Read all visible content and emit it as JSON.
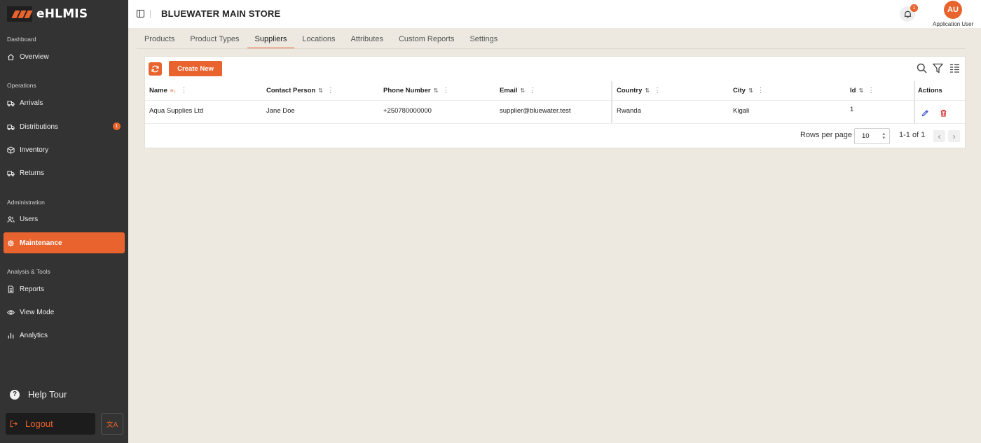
{
  "brand": {
    "name": "eHLMIS",
    "accent": "#e8632e"
  },
  "sidebar": {
    "sections": [
      {
        "label": "Dashboard"
      },
      {
        "label": "Operations"
      },
      {
        "label": "Administration"
      },
      {
        "label": "Analysis & Tools"
      }
    ],
    "items": [
      {
        "label": "Overview",
        "icon": "home-icon"
      },
      {
        "label": "Arrivals",
        "icon": "truck-icon"
      },
      {
        "label": "Distributions",
        "icon": "truck-icon",
        "badge": "1"
      },
      {
        "label": "Inventory",
        "icon": "box-icon"
      },
      {
        "label": "Returns",
        "icon": "truck-icon"
      },
      {
        "label": "Users",
        "icon": "users-icon"
      },
      {
        "label": "Maintenance",
        "icon": "gear-icon",
        "active": true
      },
      {
        "label": "Reports",
        "icon": "document-icon"
      },
      {
        "label": "View Mode",
        "icon": "eye-icon"
      },
      {
        "label": "Analytics",
        "icon": "bar-chart-icon"
      }
    ],
    "help_tour": "Help Tour",
    "logout": "Logout"
  },
  "header": {
    "store_title": "BLUEWATER MAIN STORE",
    "notification_count": "1",
    "avatar_initials": "AU",
    "user_name": "Application User"
  },
  "tabs": [
    {
      "label": "Products"
    },
    {
      "label": "Product Types"
    },
    {
      "label": "Suppliers",
      "active": true
    },
    {
      "label": "Locations"
    },
    {
      "label": "Attributes"
    },
    {
      "label": "Custom Reports"
    },
    {
      "label": "Settings"
    }
  ],
  "toolbar": {
    "create_label": "Create New"
  },
  "table": {
    "columns": [
      "Name",
      "Contact Person",
      "Phone Number",
      "Email",
      "Country",
      "City",
      "Id",
      "Actions"
    ],
    "rows": [
      {
        "name": "Aqua Supplies Ltd",
        "contact": "Jane Doe",
        "phone": "+250780000000",
        "email": "supplier@bluewater.test",
        "country": "Rwanda",
        "city": "Kigali",
        "id": "1"
      }
    ]
  },
  "pagination": {
    "rows_per_page_label": "Rows per page",
    "rows_per_page": "10",
    "range": "1-1 of 1"
  }
}
